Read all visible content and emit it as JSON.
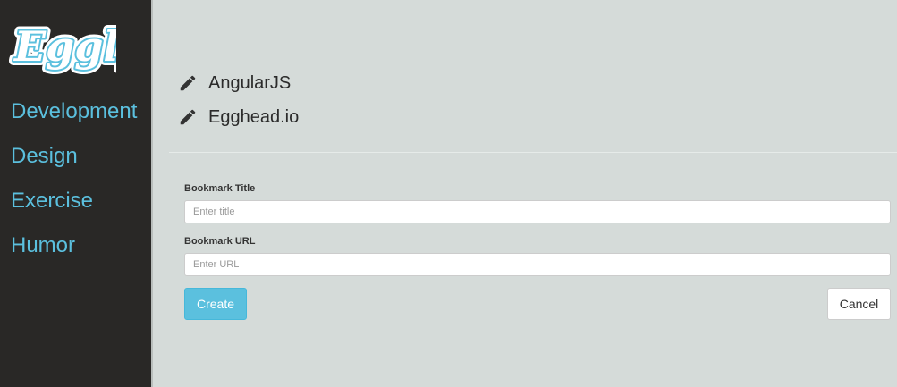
{
  "app": {
    "logo_text": "Eggly"
  },
  "sidebar": {
    "categories": [
      {
        "label": "Development"
      },
      {
        "label": "Design"
      },
      {
        "label": "Exercise"
      },
      {
        "label": "Humor"
      }
    ]
  },
  "bookmarks": [
    {
      "title": "AngularJS",
      "icon": "pencil-icon"
    },
    {
      "title": "Egghead.io",
      "icon": "pencil-icon"
    }
  ],
  "form": {
    "title_label": "Bookmark Title",
    "title_placeholder": "Enter title",
    "url_label": "Bookmark URL",
    "url_placeholder": "Enter URL",
    "create_label": "Create",
    "cancel_label": "Cancel"
  },
  "colors": {
    "sidebar_bg": "#292826",
    "accent": "#5bc0de",
    "main_bg": "#d5dbd9"
  }
}
